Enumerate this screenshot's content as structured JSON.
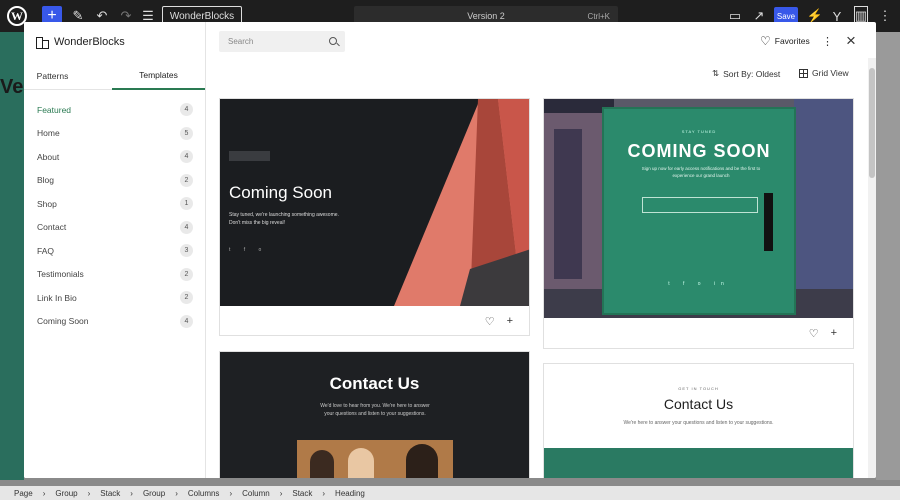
{
  "topbar": {
    "doc_title": "Version 2",
    "shortcut": "Ctrl+K",
    "plugin_label": "WonderBlocks",
    "save_label": "Save"
  },
  "background": {
    "heading_fragment": "Ve"
  },
  "modal": {
    "brand": "WonderBlocks",
    "tabs": [
      "Patterns",
      "Templates"
    ],
    "active_tab": "Templates",
    "categories": [
      {
        "label": "Featured",
        "count": "4"
      },
      {
        "label": "Home",
        "count": "5"
      },
      {
        "label": "About",
        "count": "4"
      },
      {
        "label": "Blog",
        "count": "2"
      },
      {
        "label": "Shop",
        "count": "1"
      },
      {
        "label": "Contact",
        "count": "4"
      },
      {
        "label": "FAQ",
        "count": "3"
      },
      {
        "label": "Testimonials",
        "count": "2"
      },
      {
        "label": "Link In Bio",
        "count": "2"
      },
      {
        "label": "Coming Soon",
        "count": "4"
      }
    ],
    "search_placeholder": "Search",
    "favorites_label": "Favorites",
    "sort_label": "Sort By: Oldest",
    "view_label": "Grid View",
    "cards": [
      {
        "title": "Coming Soon",
        "subtitle": "Stay tuned, we're launching something awesome. Don't miss the big reveal!"
      },
      {
        "title": "COMING SOON",
        "kicker": "STAY TUNED",
        "subtitle": "Sign up now for early access notifications and be the first to experience our grand launch"
      },
      {
        "title": "Contact Us",
        "subtitle": "We'd love to hear from you. We're here to answer your questions and listen to your suggestions."
      },
      {
        "title": "Contact Us",
        "kicker": "GET IN TOUCH",
        "subtitle": "We're here to answer your questions and listen to your suggestions."
      }
    ]
  },
  "breadcrumb": [
    "Page",
    "Group",
    "Stack",
    "Group",
    "Columns",
    "Column",
    "Stack",
    "Heading"
  ],
  "colors": {
    "accent": "#2a7a52",
    "wp_blue": "#3858e9",
    "topbar": "#1e1e1e"
  }
}
